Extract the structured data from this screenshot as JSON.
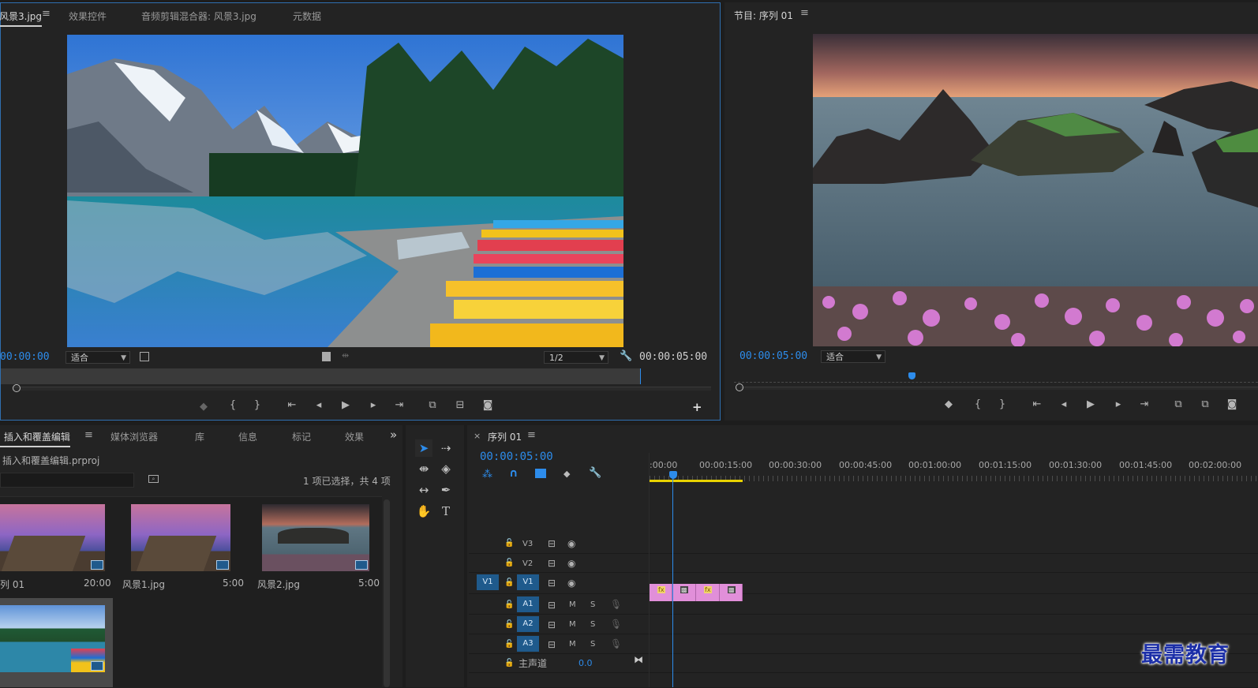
{
  "source_panel": {
    "tabs": [
      "风景3.jpg",
      "效果控件",
      "音频剪辑混合器: 风景3.jpg",
      "元数据"
    ],
    "timecode_in": "00:00:00",
    "zoom_select": "适合",
    "resolution_select": "1/2",
    "timecode_duration": "00:00:05:00",
    "add_button": "+"
  },
  "program_panel": {
    "title": "节目: 序列 01",
    "timecode": "00:00:05:00",
    "zoom_select": "适合"
  },
  "project_panel": {
    "tabs": [
      "ː 插入和覆盖编辑",
      "媒体浏览器",
      "库",
      "信息",
      "标记",
      "效果"
    ],
    "overflow": "»",
    "project_file": "插入和覆盖编辑.prproj",
    "selection_info": "1 项已选择，共 4 项",
    "items": [
      {
        "name": "列 01",
        "duration": "20:00"
      },
      {
        "name": "风景1.jpg",
        "duration": "5:00"
      },
      {
        "name": "风景2.jpg",
        "duration": "5:00"
      }
    ]
  },
  "timeline": {
    "close": "×",
    "tab": "序列 01",
    "timecode": "00:00:05:00",
    "ruler": [
      ":00:00",
      "00:00:15:00",
      "00:00:30:00",
      "00:00:45:00",
      "00:01:00:00",
      "00:01:15:00",
      "00:01:30:00",
      "00:01:45:00",
      "00:02:00:00"
    ],
    "video_tracks": [
      "V3",
      "V2",
      "V1"
    ],
    "audio_tracks": [
      "A1",
      "A2",
      "A3"
    ],
    "source_patch": "V1",
    "mute": "M",
    "solo": "S",
    "master_label": "主声道",
    "master_value": "0.0",
    "fx_badge": "fx"
  },
  "watermark": "最需教育",
  "colors": {
    "accent": "#2d8ceb",
    "clip": "#e18fd9",
    "track_button": "#1f5a8c",
    "work_area": "#e8d200"
  }
}
